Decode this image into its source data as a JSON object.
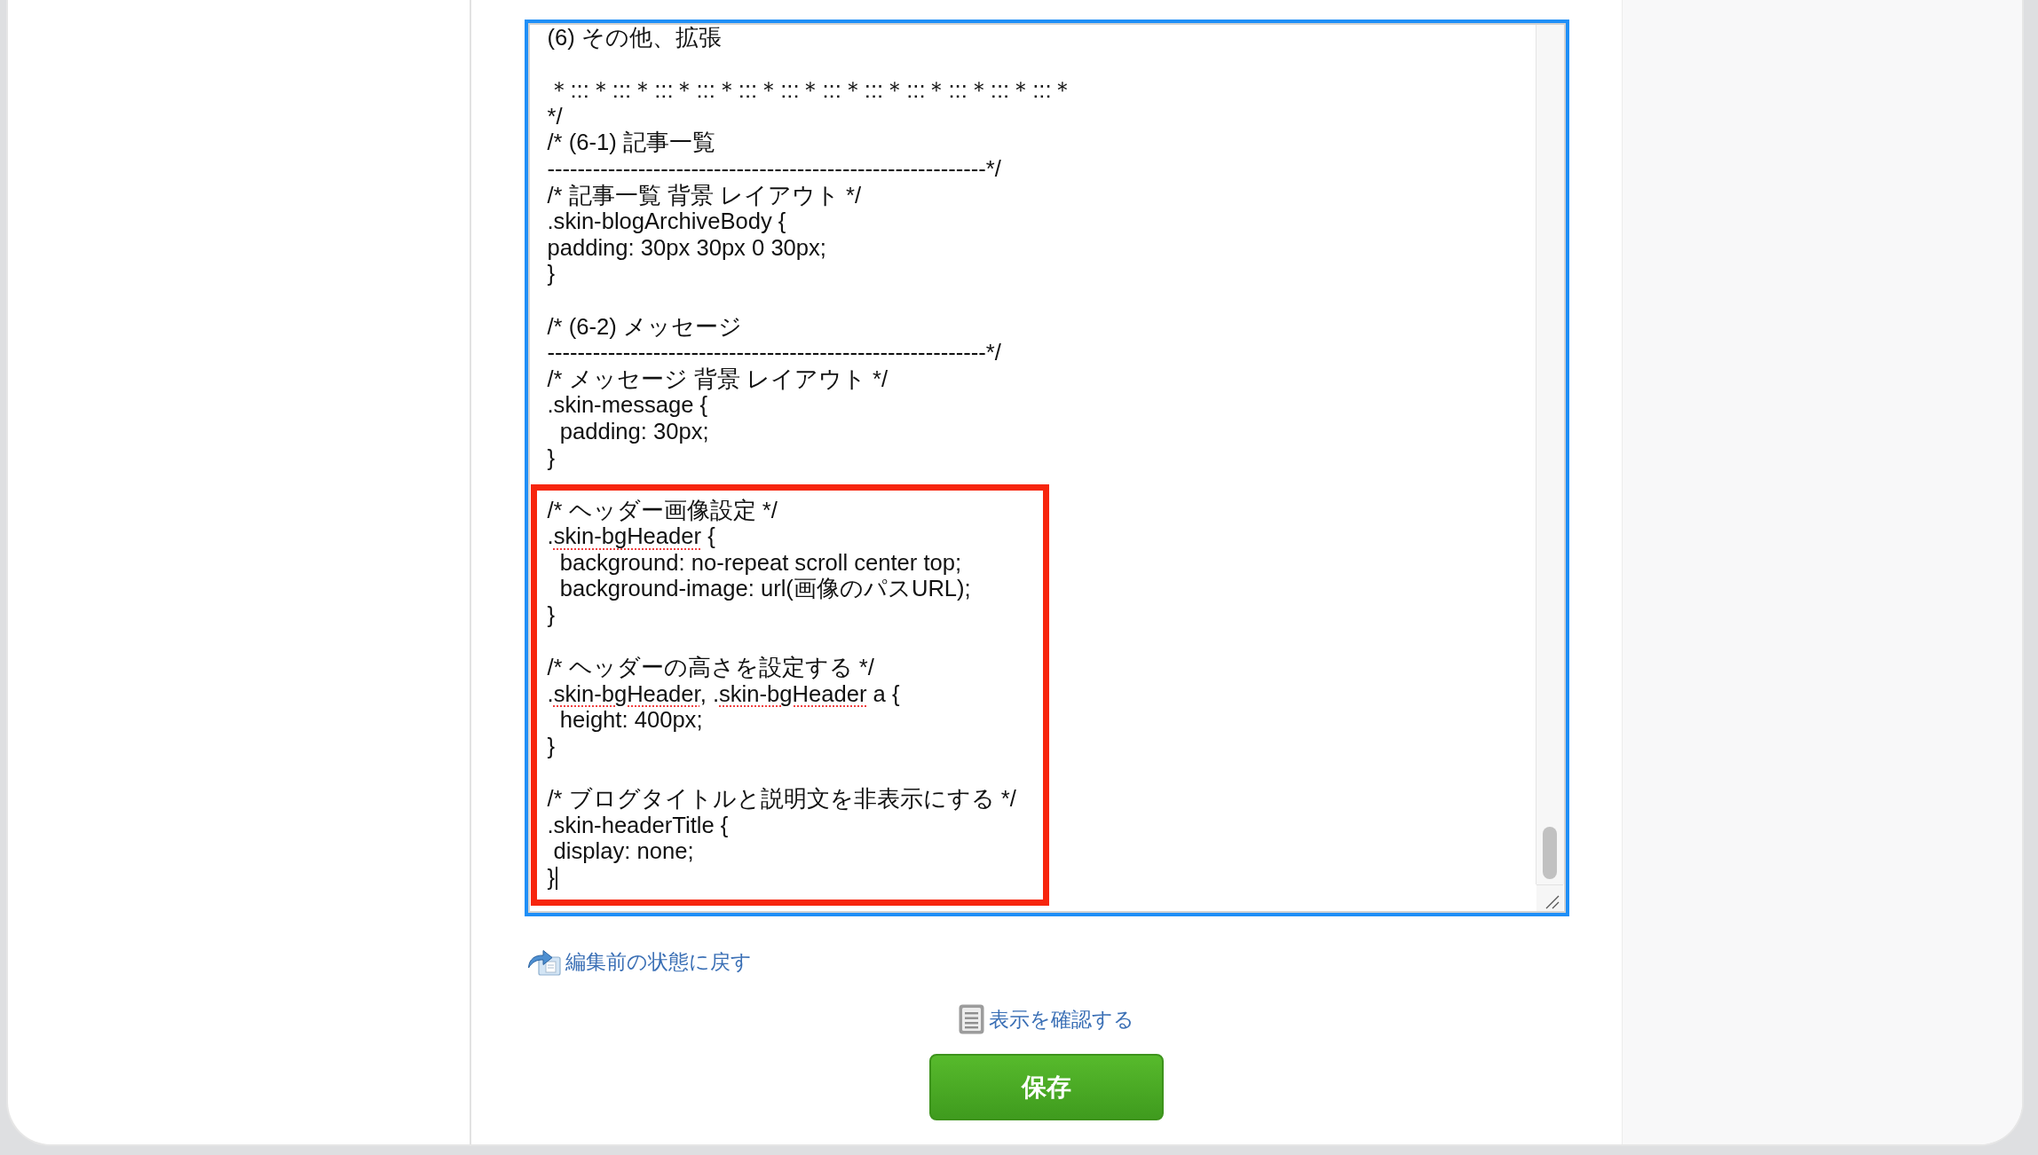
{
  "editor": {
    "blocks": [
      {
        "highlighted": false,
        "lines": [
          {
            "kind": "text",
            "text": "(6) その他、拡張"
          },
          {
            "kind": "blank"
          },
          {
            "kind": "text",
            "text": "＊:::＊:::＊:::＊:::＊:::＊:::＊:::＊:::＊:::＊:::＊:::＊:::＊"
          },
          {
            "kind": "text",
            "text": "*/"
          },
          {
            "kind": "text",
            "text": "/* (6-1) 記事一覧"
          },
          {
            "kind": "text",
            "text": "----------------------------------------------------------*/"
          },
          {
            "kind": "text",
            "text": "/* 記事一覧 背景 レイアウト */"
          },
          {
            "kind": "text",
            "text": ".skin-blogArchiveBody {"
          },
          {
            "kind": "text",
            "text": "padding: 30px 30px 0 30px;"
          },
          {
            "kind": "text",
            "text": "}"
          },
          {
            "kind": "blank"
          },
          {
            "kind": "text",
            "text": "/* (6-2) メッセージ"
          },
          {
            "kind": "text",
            "text": "----------------------------------------------------------*/"
          },
          {
            "kind": "text",
            "text": "/* メッセージ 背景 レイアウト */"
          },
          {
            "kind": "text",
            "text": ".skin-message {"
          },
          {
            "kind": "text",
            "text": "  padding: 30px;"
          },
          {
            "kind": "text",
            "text": "}"
          },
          {
            "kind": "blank"
          }
        ]
      },
      {
        "highlighted": true,
        "lines": [
          {
            "kind": "text",
            "text": "/* ヘッダー画像設定 */"
          },
          {
            "kind": "spellcheck",
            "parts": [
              {
                "text": ".",
                "misspelled": false
              },
              {
                "text": "skin-bgHeader",
                "misspelled": true
              },
              {
                "text": " {",
                "misspelled": false
              }
            ]
          },
          {
            "kind": "text",
            "text": "  background: no-repeat scroll center top;"
          },
          {
            "kind": "text",
            "text": "  background-image: url(画像のパスURL);"
          },
          {
            "kind": "text",
            "text": "}"
          },
          {
            "kind": "blank"
          },
          {
            "kind": "text",
            "text": "/* ヘッダーの高さを設定する */"
          },
          {
            "kind": "spellcheck",
            "parts": [
              {
                "text": ".",
                "misspelled": false
              },
              {
                "text": "skin-bgHeader",
                "misspelled": true
              },
              {
                "text": ", .",
                "misspelled": false
              },
              {
                "text": "skin-bgHeader",
                "misspelled": true
              },
              {
                "text": " a {",
                "misspelled": false
              }
            ]
          },
          {
            "kind": "text",
            "text": "  height: 400px;"
          },
          {
            "kind": "text",
            "text": "}"
          },
          {
            "kind": "blank"
          },
          {
            "kind": "text",
            "text": "/* ブログタイトルと説明文を非表示にする */"
          },
          {
            "kind": "text",
            "text": ".skin-headerTitle {"
          },
          {
            "kind": "text",
            "text": " display: none;"
          },
          {
            "kind": "text",
            "text": "}"
          }
        ]
      }
    ],
    "caret_at_end": true
  },
  "revert_link": "編集前の状態に戻す",
  "preview_link": "表示を確認する",
  "save_button": "保存"
}
